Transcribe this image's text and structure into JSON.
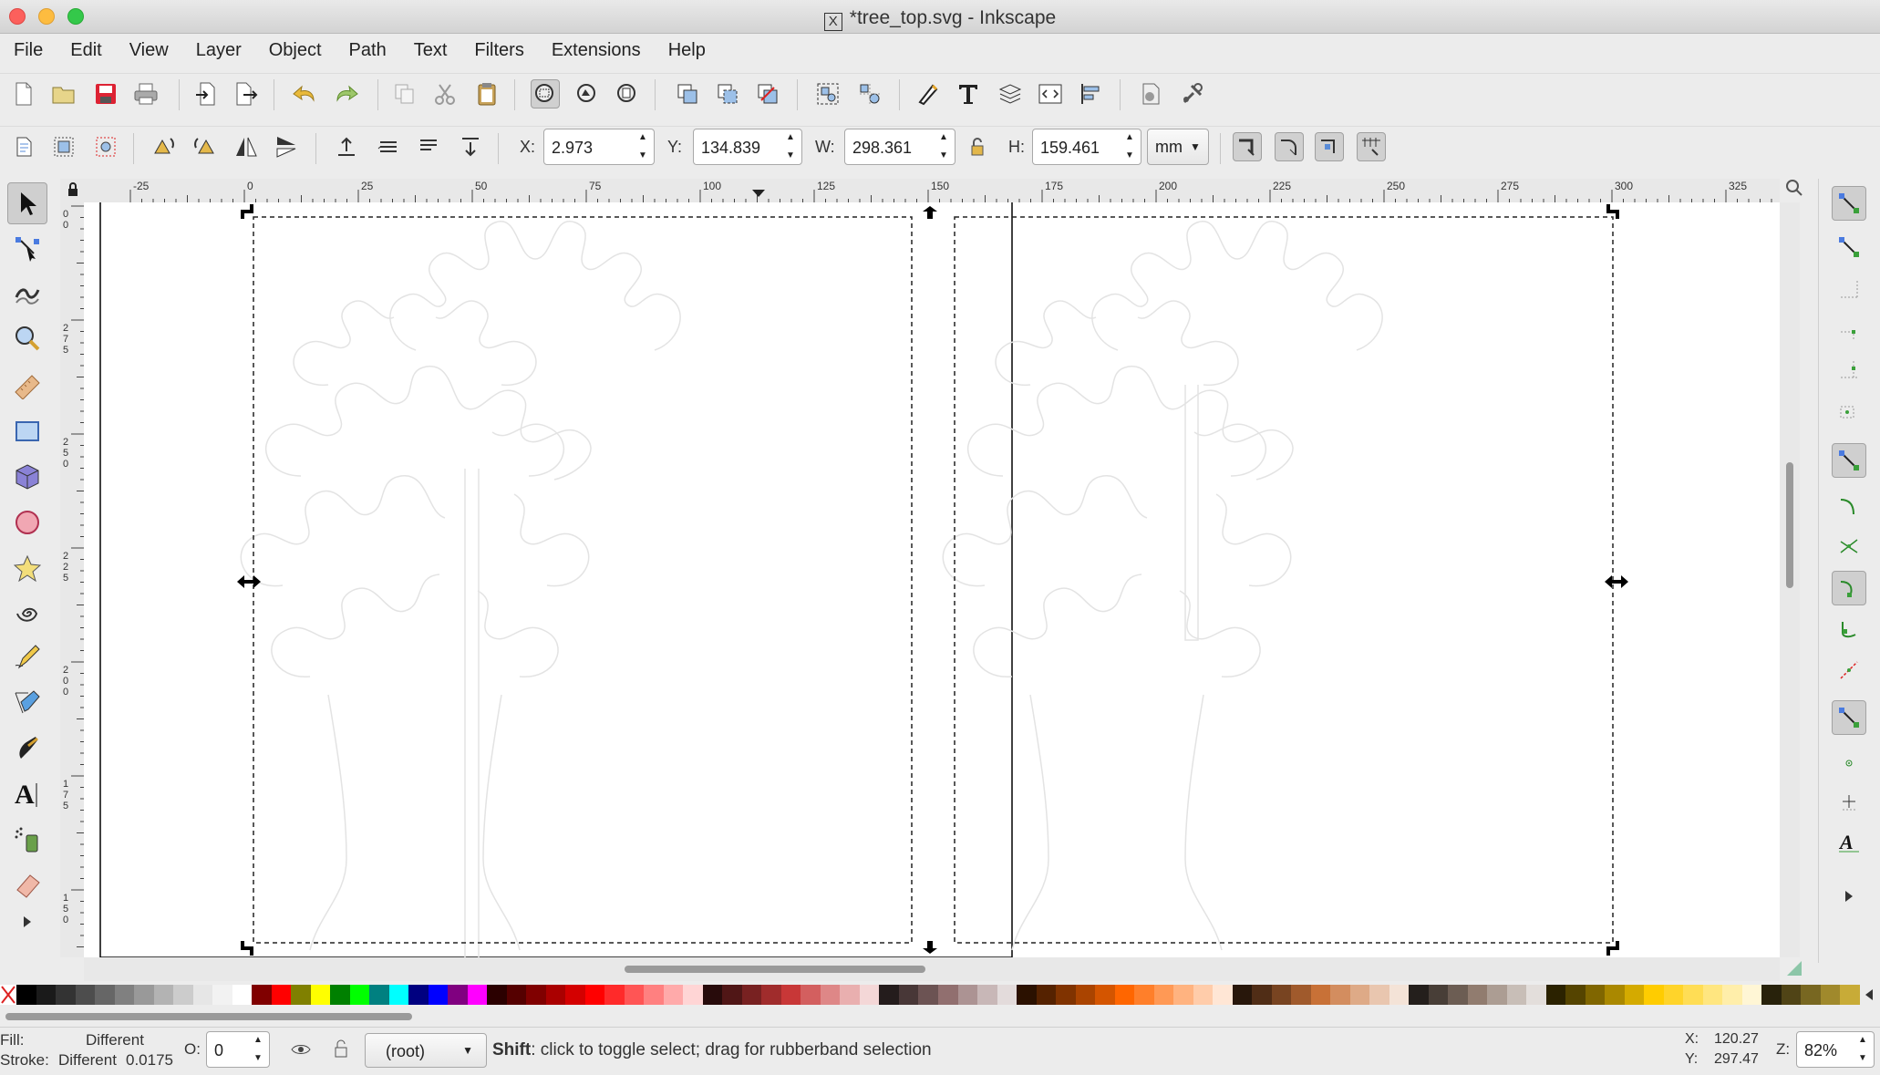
{
  "window": {
    "title": "*tree_top.svg - Inkscape"
  },
  "menu": [
    "File",
    "Edit",
    "View",
    "Layer",
    "Object",
    "Path",
    "Text",
    "Filters",
    "Extensions",
    "Help"
  ],
  "toolbar_commands": {
    "icons": [
      "new-document-icon",
      "open-file-icon",
      "save-icon",
      "print-icon",
      "import-icon",
      "export-icon",
      "undo-icon",
      "redo-icon",
      "copy-icon",
      "cut-icon",
      "paste-icon",
      "zoom-selection-icon",
      "zoom-drawing-icon",
      "zoom-page-icon",
      "duplicate-icon",
      "clone-icon",
      "unlink-clone-icon",
      "group-icon",
      "ungroup-icon",
      "fill-stroke-icon",
      "text-font-icon",
      "layers-icon",
      "xml-editor-icon",
      "align-distribute-icon",
      "document-properties-icon",
      "preferences-icon"
    ]
  },
  "toolbar_select": {
    "x_label": "X:",
    "x_value": "2.973",
    "y_label": "Y:",
    "y_value": "134.839",
    "w_label": "W:",
    "w_value": "298.361",
    "h_label": "H:",
    "h_value": "159.461",
    "unit": "mm"
  },
  "tools": [
    "selector-tool-icon",
    "node-tool-icon",
    "tweak-tool-icon",
    "zoom-tool-icon",
    "measure-tool-icon",
    "rectangle-tool-icon",
    "3d-box-tool-icon",
    "ellipse-tool-icon",
    "star-tool-icon",
    "spiral-tool-icon",
    "pencil-tool-icon",
    "pen-tool-icon",
    "calligraphy-tool-icon",
    "text-tool-icon",
    "spray-tool-icon",
    "eraser-tool-icon",
    "more-tools-arrow-icon"
  ],
  "rulers": {
    "horizontal_labels": [
      "-25",
      "0",
      "25",
      "50",
      "75",
      "100",
      "125",
      "150",
      "175",
      "200",
      "225",
      "250",
      "275",
      "300",
      "325"
    ],
    "vertical_labels": [
      "0\n0",
      "2\n7\n5",
      "2\n5\n0",
      "2\n2\n5",
      "2\n0\n0",
      "1\n7\n5",
      "1\n5\n0"
    ]
  },
  "colors": {
    "accent_selection": "#000000",
    "canvas": "#ffffff",
    "tree_outline": "#e3e3e3"
  },
  "palette": [
    "#000000",
    "#1a1a1a",
    "#333333",
    "#4d4d4d",
    "#666666",
    "#808080",
    "#999999",
    "#b3b3b3",
    "#cccccc",
    "#e6e6e6",
    "#f2f2f2",
    "#ffffff",
    "#800000",
    "#ff0000",
    "#808000",
    "#ffff00",
    "#008000",
    "#00ff00",
    "#008080",
    "#00ffff",
    "#000080",
    "#0000ff",
    "#800080",
    "#ff00ff",
    "#2b0000",
    "#550000",
    "#800000",
    "#aa0000",
    "#d40000",
    "#ff0000",
    "#ff2a2a",
    "#ff5555",
    "#ff8080",
    "#ffaaaa",
    "#ffd5d5",
    "#280b0b",
    "#501616",
    "#782121",
    "#a02c2c",
    "#c83737",
    "#d35f5f",
    "#de8787",
    "#e9afaf",
    "#f4d7d7",
    "#241c1c",
    "#483737",
    "#6c5353",
    "#916f6f",
    "#ac9393",
    "#c8b7b7",
    "#e3dbdb",
    "#2b1100",
    "#552200",
    "#803300",
    "#aa4400",
    "#d45500",
    "#ff6600",
    "#ff7f2a",
    "#ff9955",
    "#ffb380",
    "#ffccaa",
    "#ffe6d5",
    "#28170b",
    "#502d16",
    "#784421",
    "#a05a2c",
    "#c87137",
    "#d38d5f",
    "#deaa87",
    "#e9c6af",
    "#f4e3d7",
    "#241f1c",
    "#483e37",
    "#6c5d53",
    "#917c6f",
    "#ac9d93",
    "#c8beb7",
    "#e3dedb",
    "#2b2200",
    "#554400",
    "#806600",
    "#aa8800",
    "#d4aa00",
    "#ffcc00",
    "#ffd42a",
    "#ffdd55",
    "#ffe680",
    "#ffeeaa",
    "#fff6d5",
    "#28220b",
    "#504416",
    "#786721",
    "#a0892c",
    "#c8ab37"
  ],
  "status": {
    "fill_label": "Fill:",
    "fill_value": "Different",
    "stroke_label": "Stroke:",
    "stroke_value": "Different",
    "stroke_width": "0.0175",
    "opacity_label": "O:",
    "opacity_value": "0",
    "layer": "(root)",
    "message_key": "Shift",
    "message_text": ": click to toggle select; drag for rubberband selection",
    "x_label": "X:",
    "x_value": "120.27",
    "y_label": "Y:",
    "y_value": "297.47",
    "zoom_label": "Z:",
    "zoom_value": "82%"
  }
}
